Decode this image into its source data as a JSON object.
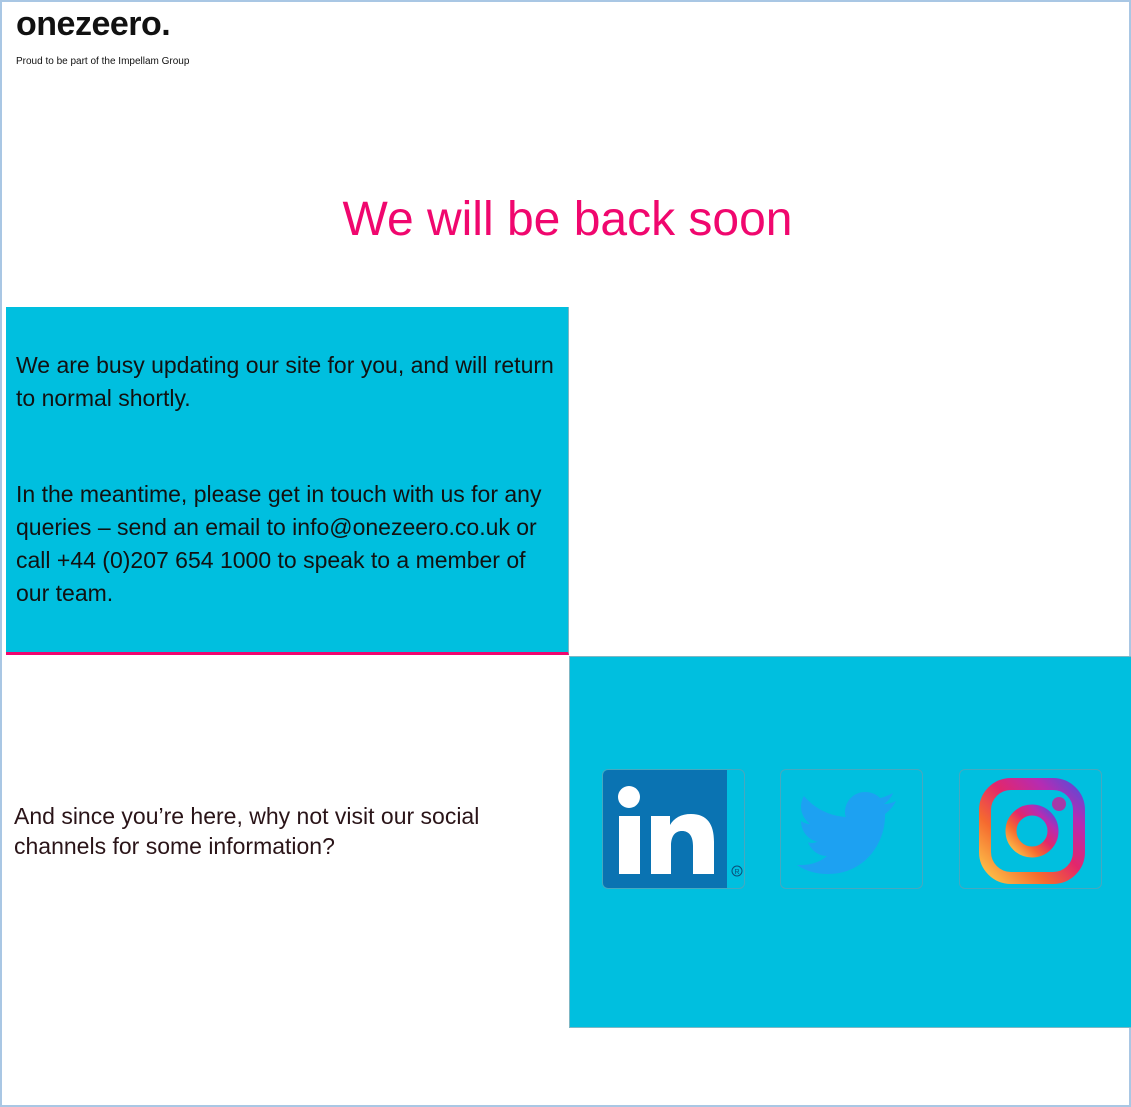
{
  "brand": {
    "logo_text": "onezeero.",
    "tagline": "Proud to be part of the Impellam Group"
  },
  "headline": "We will be back soon",
  "info": {
    "paragraph1": "We are busy updating our site for you, and will return to normal shortly.",
    "paragraph2": "In the meantime, please get in touch with us for any queries – send an email to info@onezeero.co.uk or call +44 (0)207 654 1000 to speak to a member of our team."
  },
  "social": {
    "prompt": "And since you’re here, why not visit our social channels for some information?",
    "links": [
      {
        "name": "LinkedIn",
        "icon": "linkedin-icon"
      },
      {
        "name": "Twitter",
        "icon": "twitter-icon"
      },
      {
        "name": "Instagram",
        "icon": "instagram-icon"
      }
    ]
  },
  "colors": {
    "accent_pink": "#f0076e",
    "panel_cyan": "#00bfdf",
    "linkedin_blue": "#0a73b2",
    "twitter_blue": "#1da1f2"
  }
}
